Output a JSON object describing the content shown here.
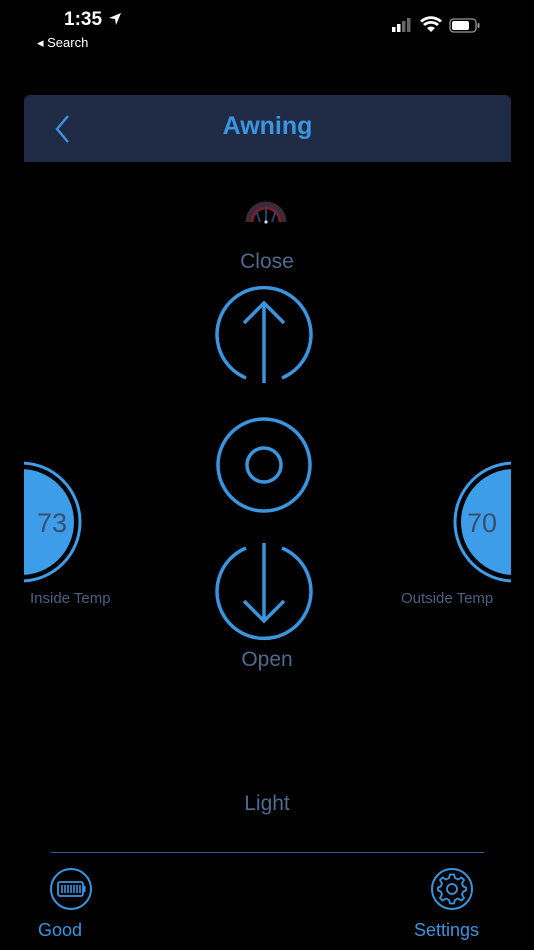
{
  "status_bar": {
    "time": "1:35",
    "back_label": "◂ Search"
  },
  "header": {
    "title": "Awning"
  },
  "controls": {
    "close_label": "Close",
    "open_label": "Open",
    "light_label": "Light"
  },
  "gauges": {
    "inside": {
      "value": "73",
      "label": "Inside Temp"
    },
    "outside": {
      "value": "70",
      "label": "Outside Temp"
    }
  },
  "bottom_nav": {
    "good_label": "Good",
    "settings_label": "Settings"
  },
  "colors": {
    "accent": "#3b95de",
    "header_bg": "#1f2b45",
    "muted_label": "#4f6a8e",
    "gauge_fill": "#3d9de8"
  }
}
